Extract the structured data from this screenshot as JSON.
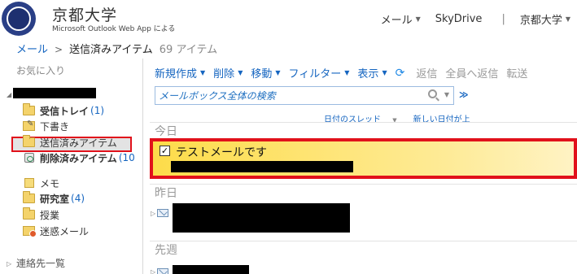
{
  "header": {
    "brand_title": "京都大学",
    "brand_sub": "Microsoft Outlook Web App による",
    "nav": {
      "mail": "メール",
      "skydrive": "SkyDrive",
      "separator": "|",
      "user": "京都大学"
    }
  },
  "breadcrumb": {
    "root": "メール",
    "arrow": ">",
    "current": "送信済みアイテム",
    "count": "69 アイテム"
  },
  "sidebar": {
    "favorites": "お気に入り",
    "folders": [
      {
        "label": "受信トレイ",
        "count": "(1)",
        "bold": true
      },
      {
        "label": "下書き",
        "count": "",
        "bold": false
      },
      {
        "label": "送信済みアイテム",
        "count": "",
        "bold": false
      },
      {
        "label": "削除済みアイテム",
        "count": "(10",
        "bold": true
      },
      {
        "label": "メモ",
        "count": "",
        "bold": false
      },
      {
        "label": "研究室",
        "count": "(4)",
        "bold": true
      },
      {
        "label": "授業",
        "count": "",
        "bold": false
      },
      {
        "label": "迷惑メール",
        "count": "",
        "bold": false
      }
    ],
    "contacts": "連絡先一覧"
  },
  "toolbar": {
    "new": "新規作成",
    "delete": "削除",
    "move": "移動",
    "filter": "フィルター",
    "view": "表示",
    "reply": "返信",
    "reply_all": "全員へ返信",
    "forward": "転送"
  },
  "search": {
    "placeholder": "メールボックス全体の検索"
  },
  "sort": {
    "thread": "日付のスレッド",
    "order": "新しい日付が上"
  },
  "groups": {
    "today": "今日",
    "yesterday": "昨日",
    "last_week": "先週"
  },
  "messages": {
    "selected_subject": "テストメールです",
    "checkmark": "✓"
  },
  "colors": {
    "accent": "#1565c0",
    "highlight_border": "#e1111b",
    "selected_row": "#fddc4a"
  }
}
